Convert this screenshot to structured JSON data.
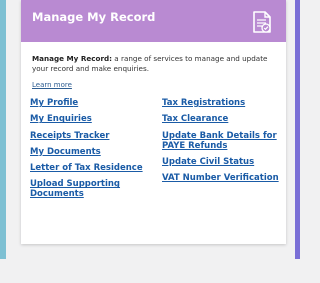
{
  "card": {
    "title": "Manage My Record",
    "icon": "document-checklist-icon",
    "description_bold": "Manage My Record:",
    "description_rest": " a range of services to manage and update your record and make enquiries.",
    "learn_more": "Learn more"
  },
  "links_left": [
    "My Profile",
    "My Enquiries",
    "Receipts Tracker",
    "My Documents",
    "Letter of Tax Residence",
    "Upload Supporting Documents"
  ],
  "links_right": [
    "Tax Registrations",
    "Tax Clearance",
    "Update Bank Details for PAYE Refunds",
    "Update Civil Status",
    "VAT Number Verification"
  ],
  "colors": {
    "header": "#b98ad2",
    "link": "#1a5ba6",
    "left_edge": "#7ec0d3",
    "right_edge": "#7a6fd6"
  }
}
